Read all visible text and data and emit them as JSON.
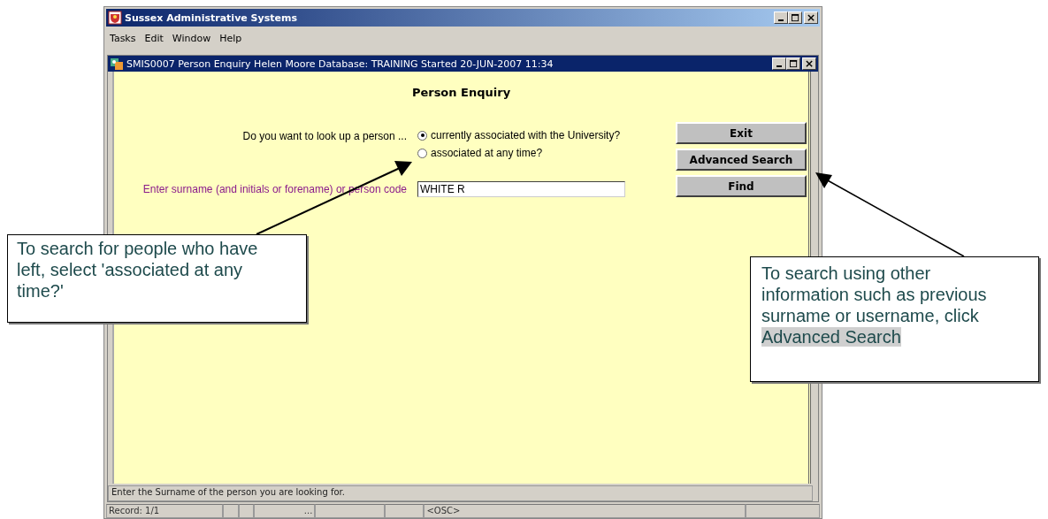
{
  "window": {
    "title": "Sussex Administrative Systems"
  },
  "menu": [
    {
      "label": "Tasks"
    },
    {
      "label": "Edit"
    },
    {
      "label": "Window"
    },
    {
      "label": "Help"
    }
  ],
  "form_window": {
    "title": "SMIS0007  Person Enquiry  Helen Moore Database: TRAINING  Started 20-JUN-2007 11:34"
  },
  "heading": "Person Enquiry",
  "question": "Do you want to look up a person ...",
  "options": [
    {
      "label": "currently associated with the University?",
      "selected": true
    },
    {
      "label": "associated at any time?",
      "selected": false
    }
  ],
  "search": {
    "label": "Enter surname (and initials or forename) or person code",
    "value": "WHITE R"
  },
  "buttons": [
    "Exit",
    "Advanced Search",
    "Find"
  ],
  "status_bar": {
    "message": "Enter the Surname of the person you are looking for.",
    "record": "Record: 1/1",
    "field_3": "...",
    "mode": "<OSC>"
  },
  "callouts": [
    {
      "text": "To search for people who have left, select 'associated at any time?'"
    },
    {
      "text": "To search using other information such as previous surname or username, click",
      "highlighted_text": "Advanced Search"
    }
  ]
}
